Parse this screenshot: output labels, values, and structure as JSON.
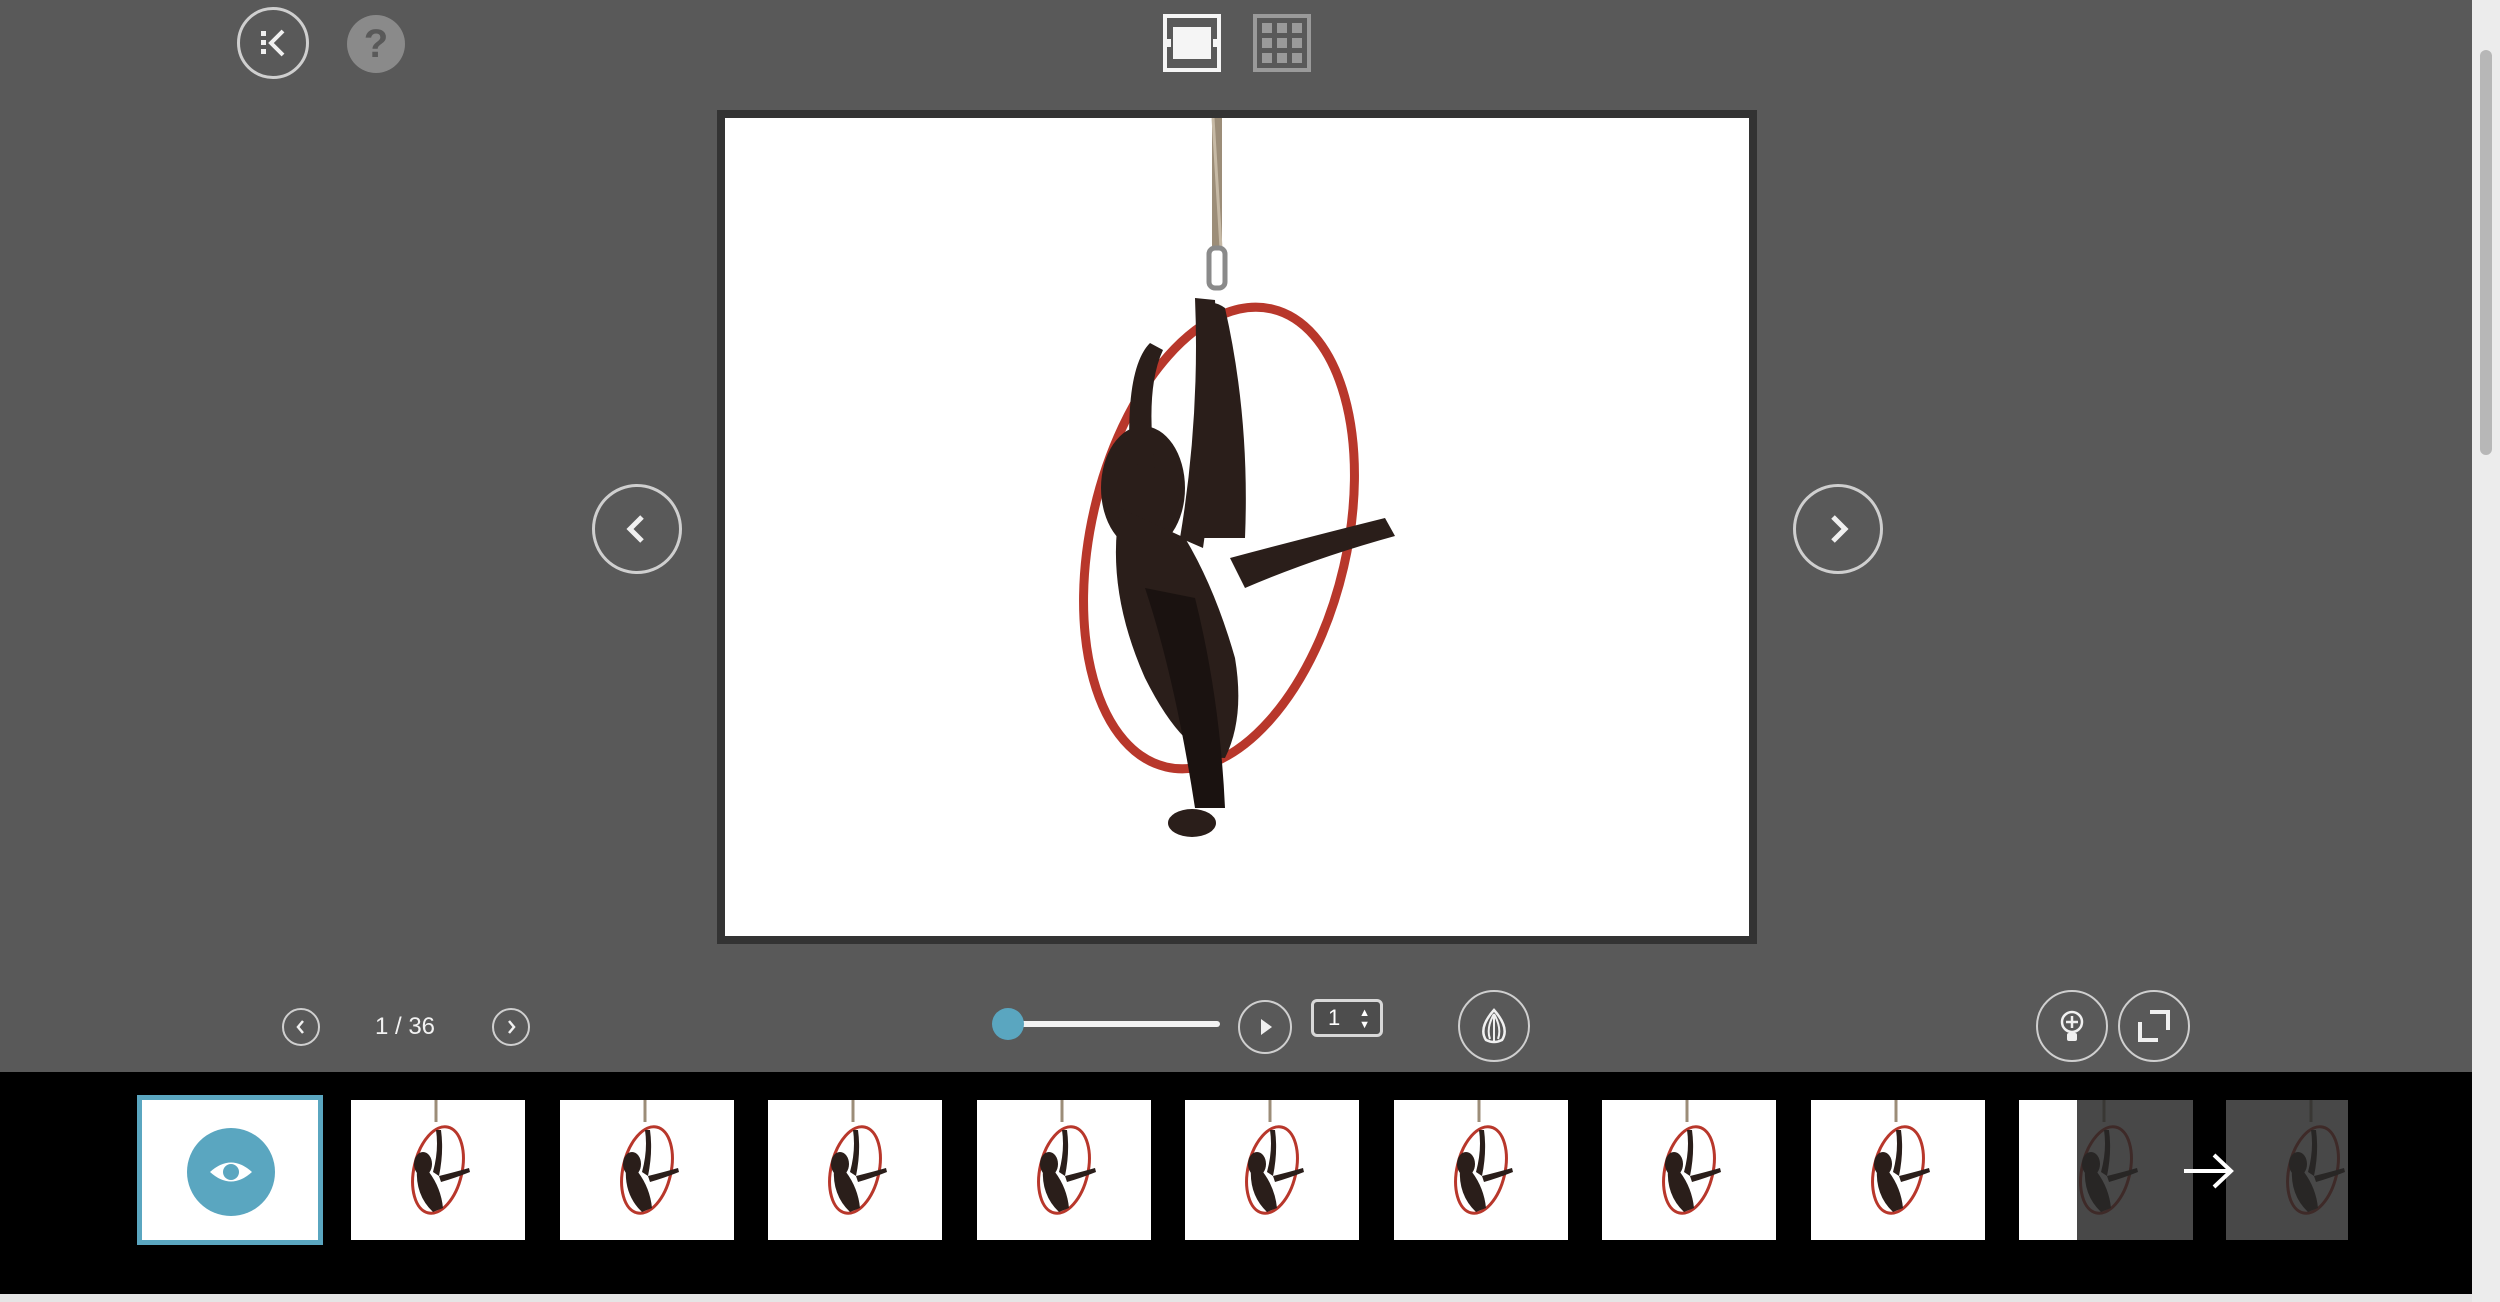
{
  "toolbar": {
    "back_icon": "collapse-left-icon",
    "help_label": "?",
    "view_modes": [
      "single-view-icon",
      "grid-view-icon"
    ],
    "active_view": "single-view-icon"
  },
  "viewer": {
    "prev_icon": "chevron-left-icon",
    "next_icon": "chevron-right-icon",
    "photo_subject": "aerial-hoop-silhouette"
  },
  "controls": {
    "page_current": 1,
    "page_total": 36,
    "page_label": "1 / 36",
    "slideshow_progress": 0,
    "speed_value": "1",
    "icons": [
      "play-icon",
      "onion-skin-icon",
      "zoom-lightbulb-icon",
      "fullscreen-icon"
    ]
  },
  "filmstrip": {
    "count_visible": 11,
    "active_index": 0,
    "more_icon": "arrow-right-icon"
  },
  "colors": {
    "background": "#595959",
    "accent": "#5aa6c0",
    "hoop": "#b8372b",
    "frame": "#333333"
  }
}
